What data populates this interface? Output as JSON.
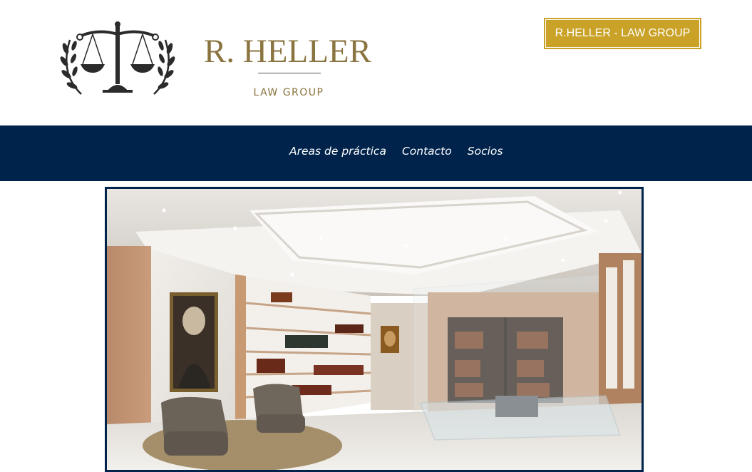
{
  "header": {
    "logo": {
      "title": "R. HELLER",
      "subtitle": "LAW GROUP",
      "icon": "scales-of-justice-icon"
    },
    "cta_label": "R.HELLER - LAW GROUP"
  },
  "nav": {
    "items": [
      {
        "label": "Areas de práctica"
      },
      {
        "label": "Contacto"
      },
      {
        "label": "Socios"
      }
    ]
  },
  "hero": {
    "image": "law-office-interior"
  },
  "colors": {
    "gold": "#c9a227",
    "logo_gold": "#8a7440",
    "navy": "#00234b",
    "icon_dark": "#2b2b2b"
  }
}
